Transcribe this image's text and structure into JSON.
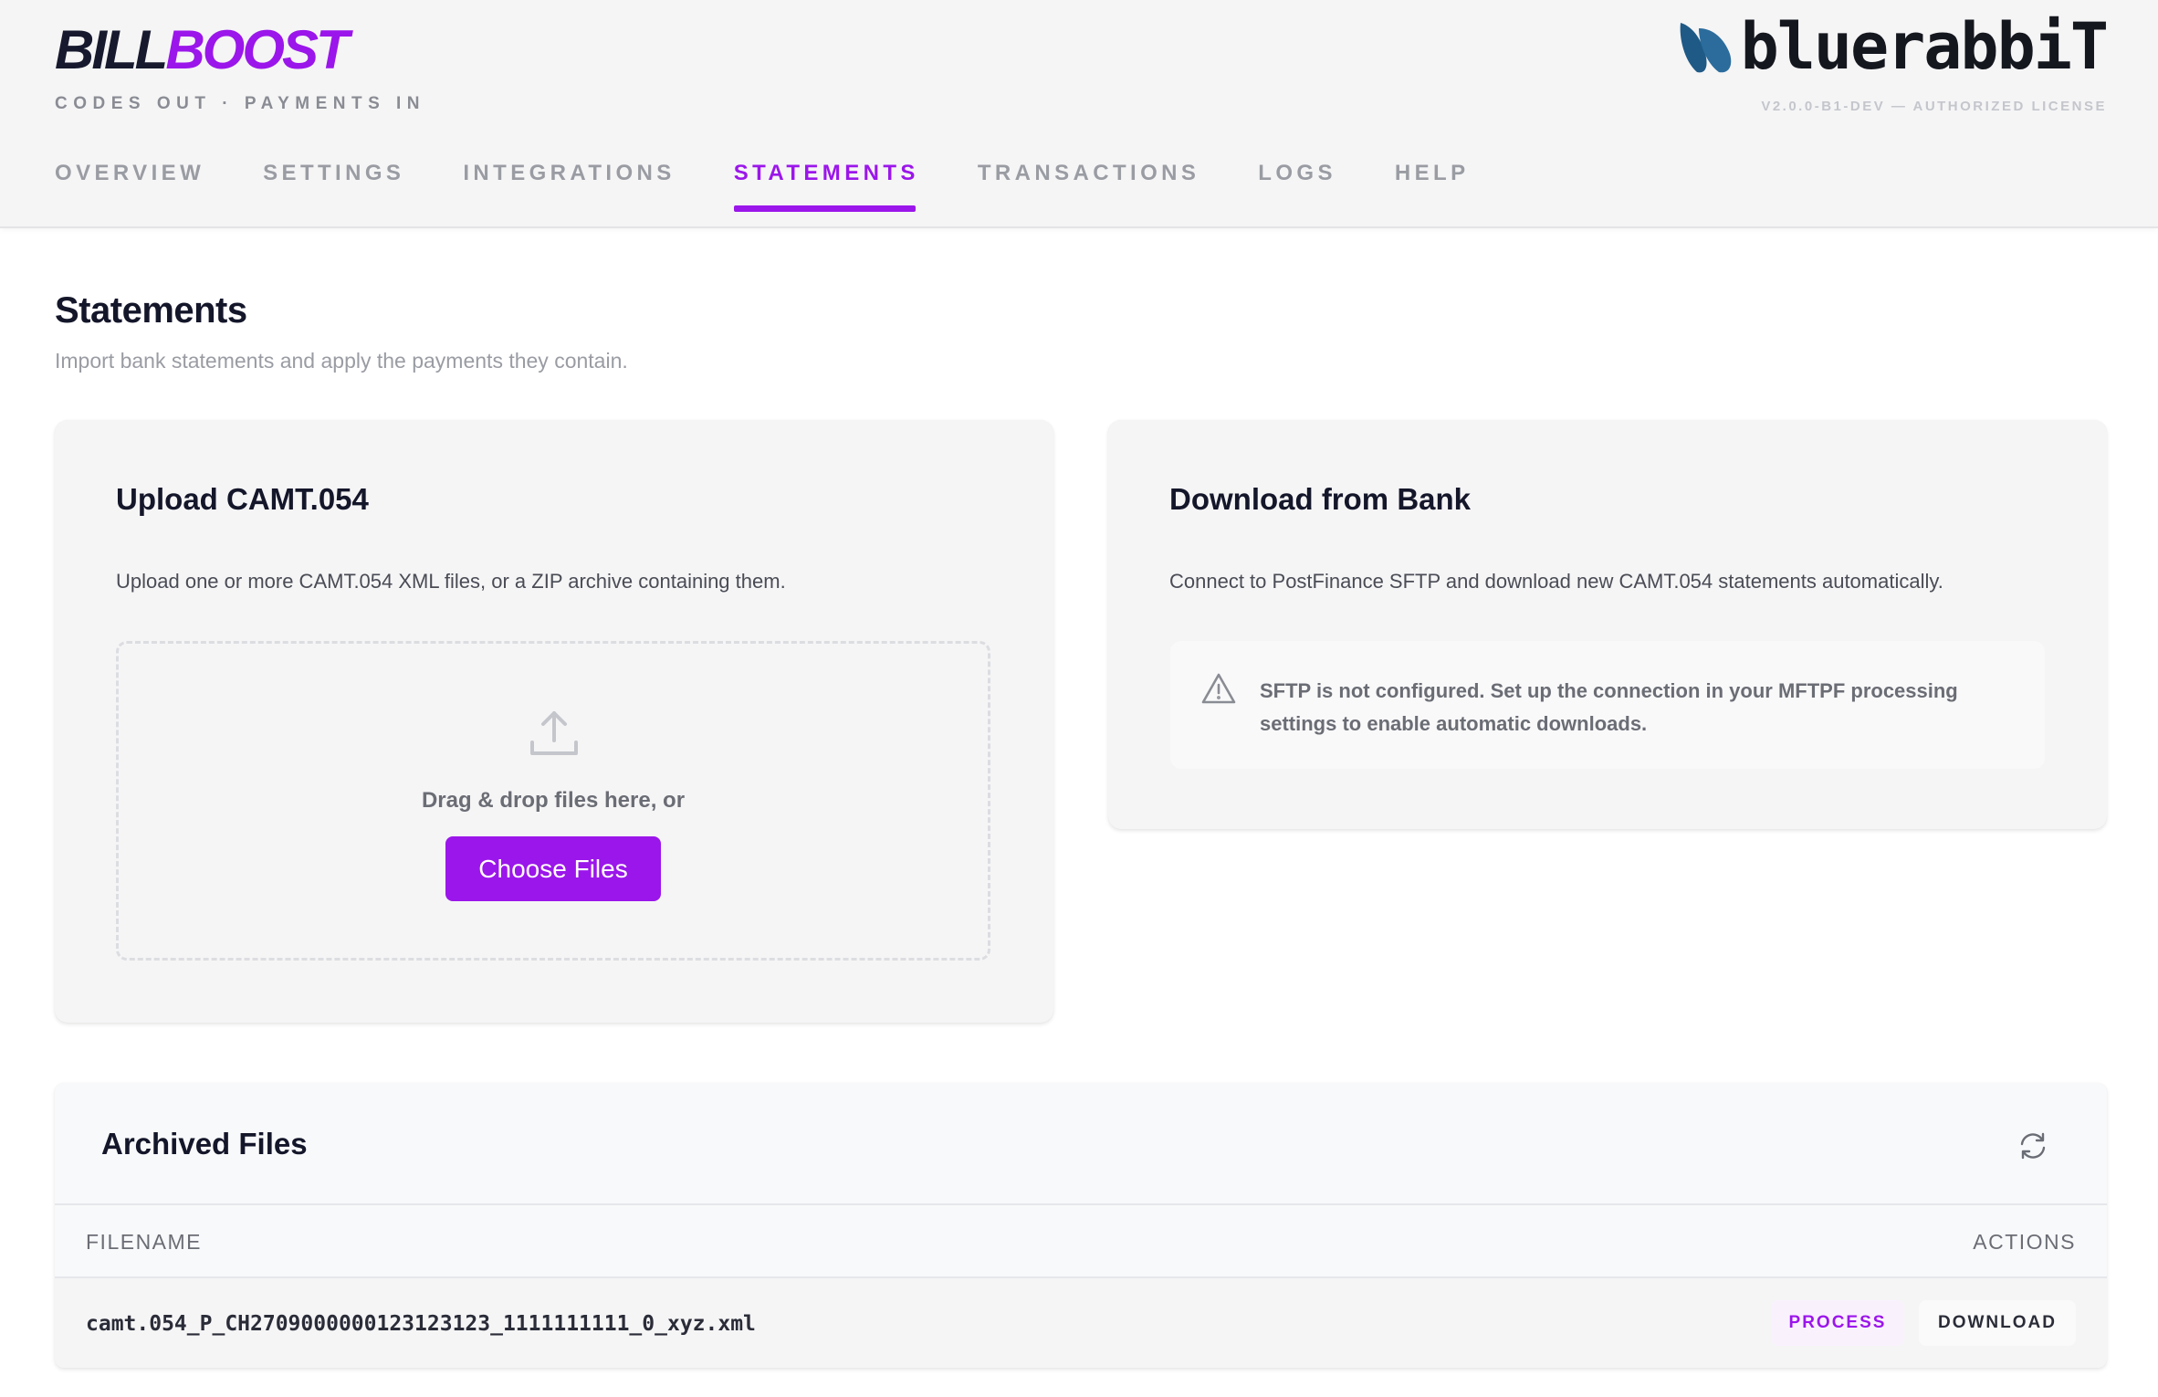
{
  "brand": {
    "part1": "BILL",
    "part2": "BOOST",
    "tagline": "CODES OUT · PAYMENTS IN"
  },
  "logo": {
    "text": "bluerabbiT",
    "version": "V2.0.0-B1-DEV — AUTHORIZED LICENSE"
  },
  "nav": {
    "items": [
      {
        "label": "OVERVIEW"
      },
      {
        "label": "SETTINGS"
      },
      {
        "label": "INTEGRATIONS"
      },
      {
        "label": "STATEMENTS",
        "active": true
      },
      {
        "label": "TRANSACTIONS"
      },
      {
        "label": "LOGS"
      },
      {
        "label": "HELP"
      }
    ]
  },
  "page": {
    "title": "Statements",
    "subtitle": "Import bank statements and apply the payments they contain."
  },
  "upload": {
    "title": "Upload CAMT.054",
    "description": "Upload one or more CAMT.054 XML files, or a ZIP archive containing them.",
    "drop_text": "Drag & drop files here, or",
    "button_label": "Choose Files"
  },
  "bank": {
    "title": "Download from Bank",
    "description": "Connect to PostFinance SFTP and download new CAMT.054 statements automatically.",
    "alert": "SFTP is not configured. Set up the connection in your MFTPF processing settings to enable automatic downloads."
  },
  "archive": {
    "title": "Archived Files",
    "columns": {
      "filename": "FILENAME",
      "actions": "ACTIONS"
    },
    "rows": [
      {
        "filename": "camt.054_P_CH2709000000123123123_1111111111_0_xyz.xml",
        "process_label": "PROCESS",
        "download_label": "DOWNLOAD"
      }
    ]
  },
  "colors": {
    "accent": "#9b16ea",
    "brand_dark": "#171a2e",
    "logo_blue": "#1f5a86"
  }
}
